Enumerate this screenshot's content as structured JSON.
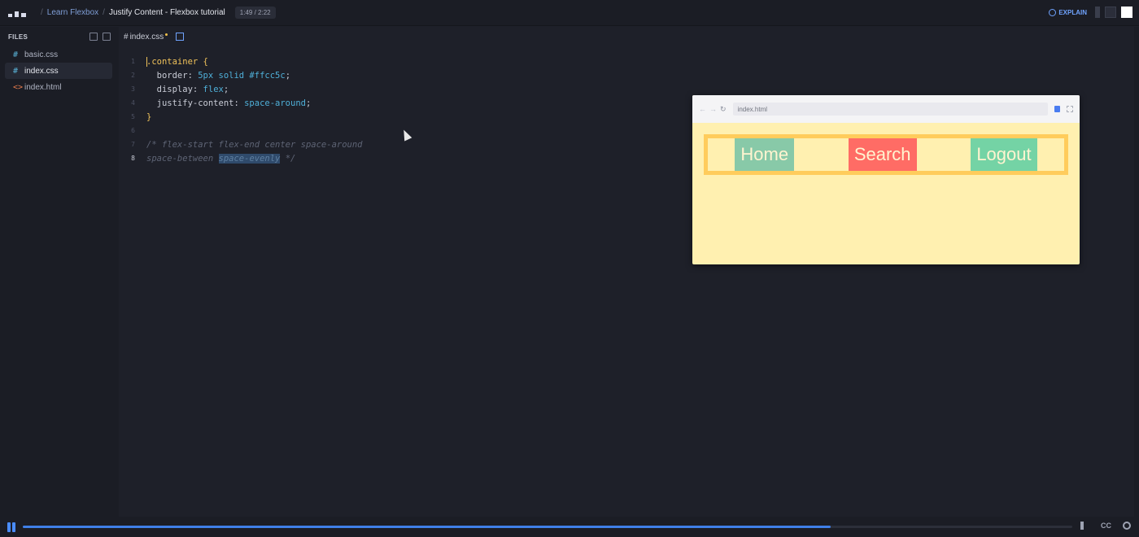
{
  "topbar": {
    "course": "Learn Flexbox",
    "lesson": "Justify Content - Flexbox tutorial",
    "time": "1:49 / 2:22",
    "explain": "EXPLAIN"
  },
  "sidebar": {
    "heading": "FILES",
    "files": [
      {
        "name": "basic.css",
        "icon": "#"
      },
      {
        "name": "index.css",
        "icon": "#"
      },
      {
        "name": "index.html",
        "icon": "<>"
      }
    ]
  },
  "editor": {
    "tab": {
      "icon": "#",
      "name": "index.css"
    },
    "lines": [
      "1",
      "2",
      "3",
      "4",
      "5",
      "6",
      "7",
      "8"
    ],
    "code": {
      "l1_sel": "container",
      "l1_brace": " {",
      "l2_prop": "  border: ",
      "l2_val": "5px solid #ffcc5c",
      "l3_prop": "  display: ",
      "l3_val": "flex",
      "l4_prop": "  justify-content: ",
      "l4_val": "space-around",
      "l5": "}",
      "l7": "/* flex-start flex-end center space-around",
      "l8a": "space-between ",
      "l8b": "space-evenly",
      "l8c": " */"
    }
  },
  "preview": {
    "address": "index.html",
    "nav": [
      "Home",
      "Search",
      "Logout"
    ]
  },
  "player": {
    "progress": 0.77,
    "cc": "CC"
  },
  "colors": {
    "accent": "#3f7fe8",
    "container_border": "#ffcc5c",
    "home": "#88c9a8",
    "search": "#ff6c65",
    "logout": "#74d3a5"
  }
}
